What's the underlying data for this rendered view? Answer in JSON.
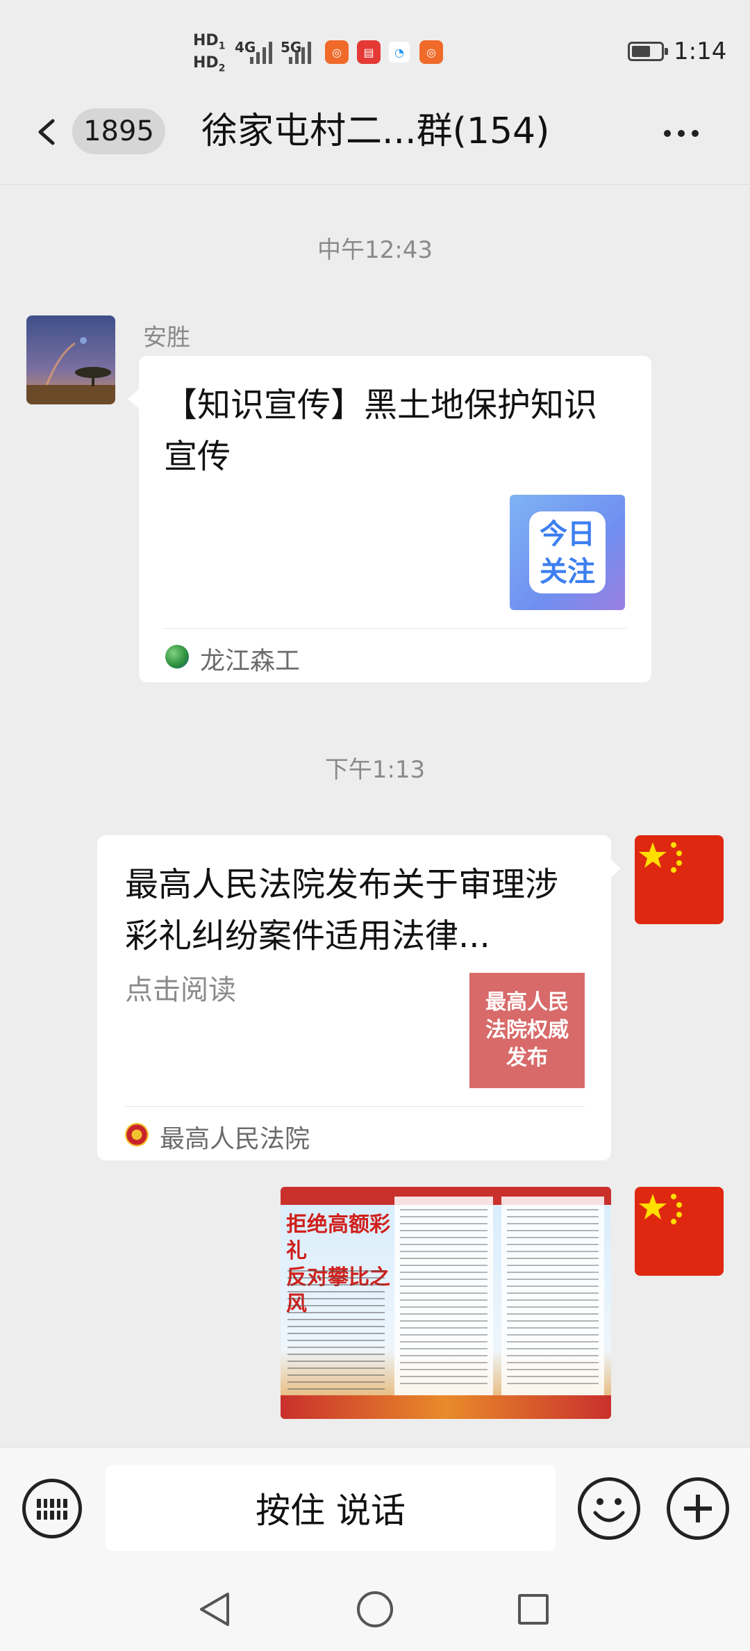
{
  "status_bar": {
    "hd1": "HD",
    "hd1_sub": "1",
    "hd2": "HD",
    "hd2_sub": "2",
    "net1": "4G",
    "net2": "5G",
    "time": "1:14",
    "app_icons": [
      "kuaishou-icon",
      "book-icon",
      "chat-icon",
      "kuaishou-icon"
    ]
  },
  "header": {
    "unread_count": "1895",
    "title": "徐家屯村二...群(154)"
  },
  "messages": [
    {
      "timestamp": "中午12:43",
      "sender": "安胜",
      "card": {
        "title": "【知识宣传】黑土地保护知识宣传",
        "thumb_text": "今日关注",
        "source": "龙江森工",
        "source_icon_text": "龙江森工"
      }
    },
    {
      "timestamp": "下午1:13",
      "card": {
        "title": "最高人民法院发布关于审理涉彩礼纠纷案件适用法律...",
        "subtitle": "点击阅读",
        "thumb_text": "最高人民法院权威发布",
        "source": "最高人民法院"
      }
    },
    {
      "image": {
        "headline_line1": "拒绝高额彩礼",
        "headline_line2": "反对攀比之风"
      }
    }
  ],
  "input_bar": {
    "voice_label": "按住 说话"
  },
  "colors": {
    "background": "#ededed",
    "bubble": "#ffffff",
    "flag_red": "#de2910",
    "flag_star": "#ffde00"
  }
}
